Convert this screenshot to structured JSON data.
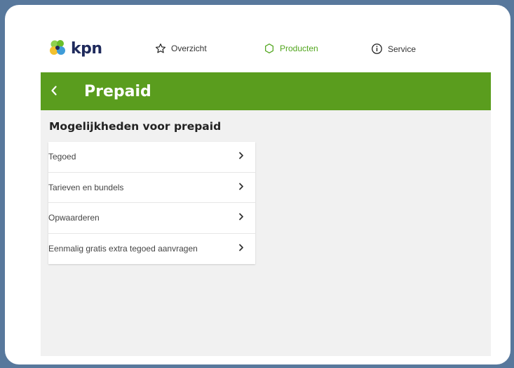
{
  "brand": {
    "name": "kpn",
    "accent": "#5a9d1e",
    "logo_text_color": "#1f2a5c"
  },
  "nav": {
    "items": [
      {
        "label": "Overzicht",
        "icon": "star-icon",
        "active": false
      },
      {
        "label": "Producten",
        "icon": "hexagon-icon",
        "active": true
      },
      {
        "label": "Service",
        "icon": "info-icon",
        "active": false
      }
    ]
  },
  "header": {
    "back_icon": "chevron-left-icon",
    "title": "Prepaid"
  },
  "section": {
    "heading": "Mogelijkheden voor prepaid",
    "items": [
      {
        "label": "Tegoed"
      },
      {
        "label": "Tarieven en bundels"
      },
      {
        "label": "Opwaarderen"
      },
      {
        "label": "Eenmalig gratis extra tegoed aanvragen"
      }
    ]
  }
}
